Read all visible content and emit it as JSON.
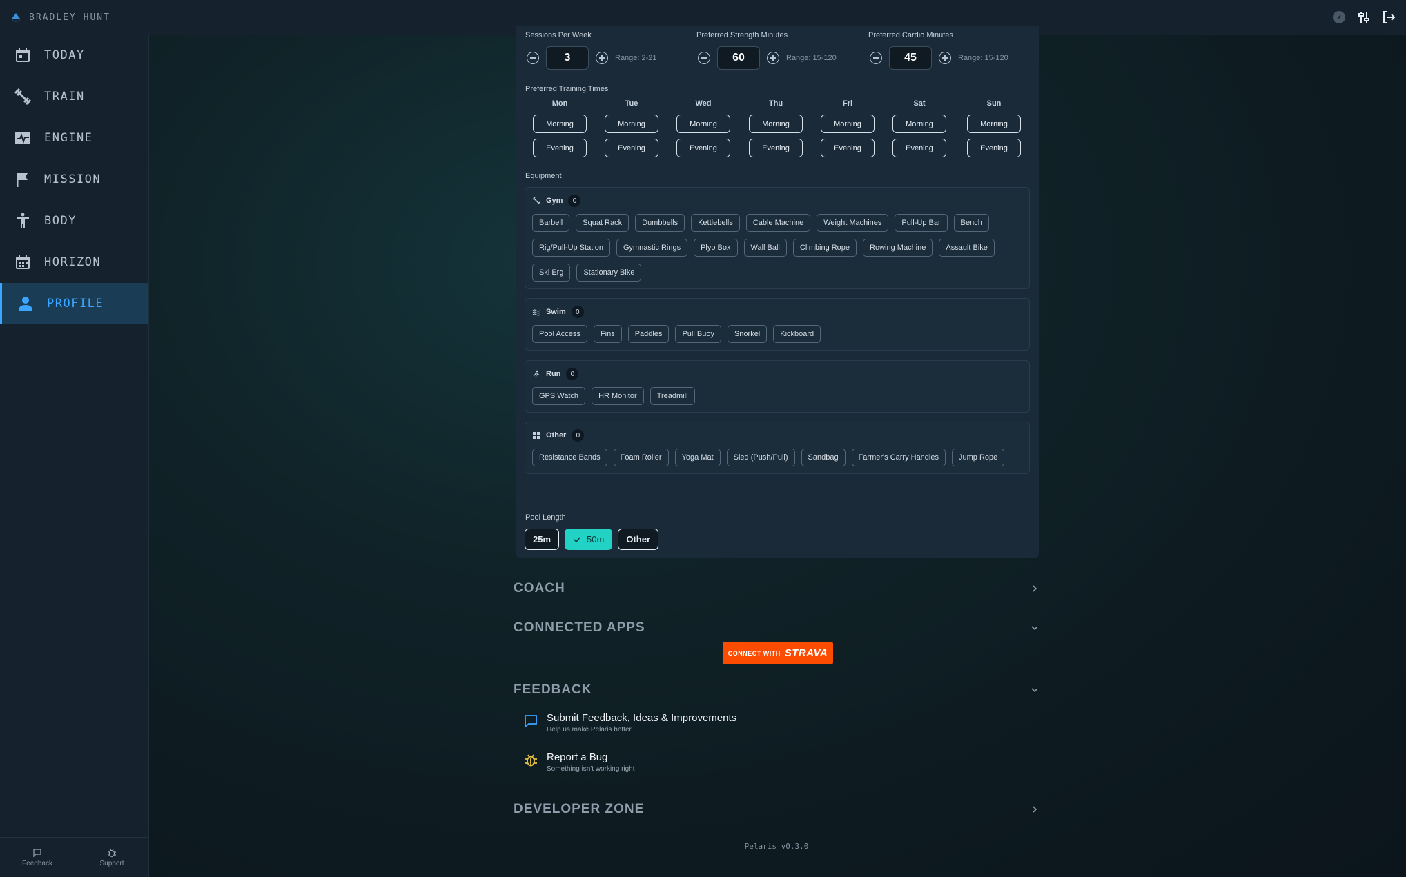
{
  "app": {
    "user_name": "BRADLEY HUNT"
  },
  "sidebar": {
    "items": [
      {
        "label": "TODAY",
        "icon": "calendar-day-icon"
      },
      {
        "label": "TRAIN",
        "icon": "dumbbell-icon"
      },
      {
        "label": "ENGINE",
        "icon": "heart-monitor-icon"
      },
      {
        "label": "MISSION",
        "icon": "flag-icon"
      },
      {
        "label": "BODY",
        "icon": "body-icon"
      },
      {
        "label": "HORIZON",
        "icon": "calendar-icon"
      },
      {
        "label": "PROFILE",
        "icon": "person-icon",
        "active": true
      }
    ],
    "footer": {
      "feedback": "Feedback",
      "support": "Support"
    }
  },
  "training": {
    "sessions": {
      "label": "Sessions Per Week",
      "value": "3",
      "range": "Range: 2-21"
    },
    "strength": {
      "label": "Preferred Strength Minutes",
      "value": "60",
      "range": "Range: 15-120"
    },
    "cardio": {
      "label": "Preferred Cardio Minutes",
      "value": "45",
      "range": "Range: 15-120"
    },
    "times_label": "Preferred Training Times",
    "days": [
      {
        "name": "Mon",
        "morning": "Morning",
        "evening": "Evening"
      },
      {
        "name": "Tue",
        "morning": "Morning",
        "evening": "Evening"
      },
      {
        "name": "Wed",
        "morning": "Morning",
        "evening": "Evening"
      },
      {
        "name": "Thu",
        "morning": "Morning",
        "evening": "Evening"
      },
      {
        "name": "Fri",
        "morning": "Morning",
        "evening": "Evening"
      },
      {
        "name": "Sat",
        "morning": "Morning",
        "evening": "Evening"
      },
      {
        "name": "Sun",
        "morning": "Morning",
        "evening": "Evening"
      }
    ]
  },
  "equipment": {
    "label": "Equipment",
    "groups": [
      {
        "name": "Gym",
        "count": "0",
        "icon": "dumbbell-icon",
        "items": [
          "Barbell",
          "Squat Rack",
          "Dumbbells",
          "Kettlebells",
          "Cable Machine",
          "Weight Machines",
          "Pull-Up Bar",
          "Bench",
          "Rig/Pull-Up Station",
          "Gymnastic Rings",
          "Plyo Box",
          "Wall Ball",
          "Climbing Rope",
          "Rowing Machine",
          "Assault Bike",
          "Ski Erg",
          "Stationary Bike"
        ]
      },
      {
        "name": "Swim",
        "count": "0",
        "icon": "waves-icon",
        "items": [
          "Pool Access",
          "Fins",
          "Paddles",
          "Pull Buoy",
          "Snorkel",
          "Kickboard"
        ]
      },
      {
        "name": "Run",
        "count": "0",
        "icon": "runner-icon",
        "items": [
          "GPS Watch",
          "HR Monitor",
          "Treadmill"
        ]
      },
      {
        "name": "Other",
        "count": "0",
        "icon": "grid-icon",
        "items": [
          "Resistance Bands",
          "Foam Roller",
          "Yoga Mat",
          "Sled (Push/Pull)",
          "Sandbag",
          "Farmer's Carry Handles",
          "Jump Rope"
        ]
      }
    ]
  },
  "pool": {
    "label": "Pool Length",
    "options": [
      {
        "label": "25m",
        "selected": false
      },
      {
        "label": "50m",
        "selected": true
      },
      {
        "label": "Other",
        "selected": false
      }
    ]
  },
  "sections": {
    "coach": "COACH",
    "connected_apps": "CONNECTED APPS",
    "strava_connect_with": "CONNECT WITH",
    "strava_brand": "STRAVA",
    "feedback": "FEEDBACK",
    "developer_zone": "DEVELOPER ZONE"
  },
  "feedback_items": {
    "submit": {
      "title": "Submit Feedback, Ideas & Improvements",
      "subtitle": "Help us make Pelaris better"
    },
    "bug": {
      "title": "Report a Bug",
      "subtitle": "Something isn't working right"
    }
  },
  "version": "Pelaris v0.3.0",
  "colors": {
    "accent": "#3aa6ff",
    "teal": "#22d3c5",
    "strava": "#fc4c02",
    "bug_icon": "#e8c33a"
  }
}
